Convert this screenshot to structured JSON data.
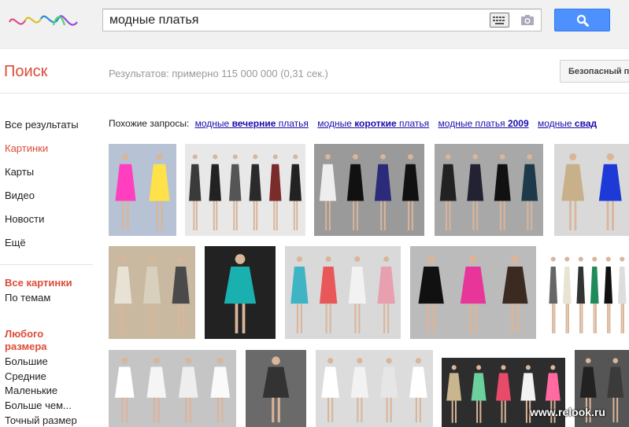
{
  "search": {
    "query": "модные платья"
  },
  "header": {
    "poisk_label": "Поиск",
    "results_text": "Результатов: примерно 115 000 000 (0,31 сек.)",
    "safe_search_label": "Безопасный п"
  },
  "sidebar": {
    "items": [
      {
        "label": "Все результаты"
      },
      {
        "label": "Картинки"
      },
      {
        "label": "Карты"
      },
      {
        "label": "Видео"
      },
      {
        "label": "Новости"
      },
      {
        "label": "Ещё"
      }
    ],
    "images_section": {
      "all_images": "Все картинки",
      "by_topic": "По темам"
    },
    "size_section": {
      "title_line1": "Любого",
      "title_line2": "размера",
      "options": [
        "Большие",
        "Средние",
        "Маленькие",
        "Больше чем...",
        "Точный размер"
      ]
    }
  },
  "related": {
    "prefix": "Похожие запросы:",
    "queries": [
      {
        "pre": "модные ",
        "bold": "вечерние",
        "post": " платья"
      },
      {
        "pre": "модные ",
        "bold": "короткие",
        "post": " платья"
      },
      {
        "pre": "модные платья ",
        "bold": "2009",
        "post": ""
      },
      {
        "pre": "модные ",
        "bold": "свад",
        "post": ""
      }
    ]
  },
  "images": [
    {
      "bg": "#b7c2d4",
      "figs": [
        "#ff3fbf",
        "#ffe14a"
      ]
    },
    {
      "bg": "#e8e8e8",
      "figs": [
        "#3a3a3a",
        "#222",
        "#555",
        "#2a2a2a",
        "#7a2b2b",
        "#222"
      ]
    },
    {
      "bg": "#9a9a9a",
      "figs": [
        "#eee",
        "#111",
        "#2b2b7a",
        "#111"
      ]
    },
    {
      "bg": "#a8a8a8",
      "figs": [
        "#222",
        "#223",
        "#111",
        "#1e3a4a"
      ]
    },
    {
      "bg": "#d9d9d9",
      "figs": [
        "#c8b08a",
        "#1e3ad6"
      ]
    },
    {
      "bg": "#c8b9a0",
      "figs": [
        "#e8e2d5",
        "#d8cfbd",
        "#4a4a4a"
      ]
    },
    {
      "bg": "#222",
      "figs": [
        "#1bb0b0"
      ]
    },
    {
      "bg": "#d9d9d9",
      "figs": [
        "#3fb5c4",
        "#e8585a",
        "#f2f2f2",
        "#e8a0b0"
      ]
    },
    {
      "bg": "#bbb",
      "figs": [
        "#111",
        "#e8359a",
        "#3b2a20"
      ]
    },
    {
      "bg": "#fff",
      "figs": [
        "#666",
        "#e8e4d4",
        "#333",
        "#1f8a5a",
        "#111",
        "#ddd"
      ]
    },
    {
      "bg": "#c5c5c5",
      "figs": [
        "#fff",
        "#f5f5f5",
        "#eee",
        "#fafafa"
      ]
    },
    {
      "bg": "#6a6a6a",
      "figs": [
        "#333"
      ]
    },
    {
      "bg": "#dcdcdc",
      "figs": [
        "#fff",
        "#f2f2f2",
        "#e6e6e6",
        "#fff"
      ]
    },
    {
      "bg": "#2d2d2d",
      "figs": [
        "#c9b58e",
        "#6bcf9e",
        "#e84a6a",
        "#f2f2f2",
        "#ff6aa0"
      ]
    },
    {
      "bg": "#555",
      "figs": [
        "#222",
        "#3b3b3b"
      ]
    }
  ],
  "watermark": "www.relook.ru"
}
